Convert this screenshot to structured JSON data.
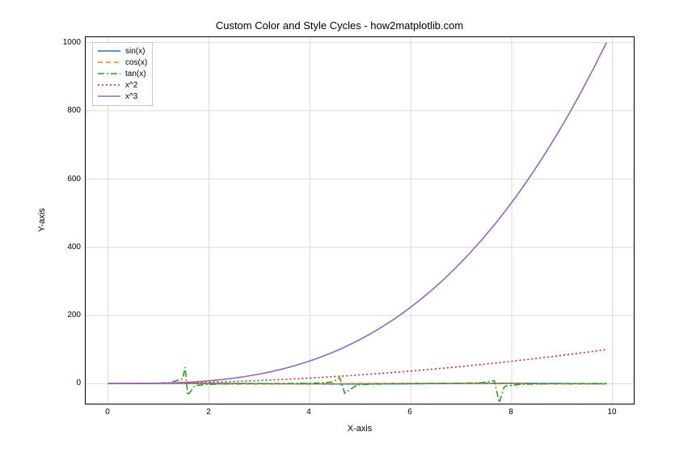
{
  "chart_data": {
    "type": "line",
    "title": "Custom Color and Style Cycles - how2matplotlib.com",
    "xlabel": "X-axis",
    "ylabel": "Y-axis",
    "xlim": [
      -0.446,
      10.546
    ],
    "ylim": [
      -58.7,
      1015.6
    ],
    "xticks": [
      0,
      2,
      4,
      6,
      8,
      10
    ],
    "yticks": [
      0,
      200,
      400,
      600,
      800,
      1000
    ],
    "grid": true,
    "legend_position": "upper-left",
    "x": [
      0,
      0.25,
      0.5,
      0.75,
      1,
      1.25,
      1.5,
      1.55,
      1.6,
      1.75,
      2,
      2.25,
      2.5,
      2.75,
      3,
      3.25,
      3.5,
      3.75,
      4,
      4.25,
      4.5,
      4.65,
      4.75,
      5,
      5.25,
      5.5,
      5.75,
      6,
      6.25,
      6.5,
      6.75,
      7,
      7.25,
      7.5,
      7.75,
      7.85,
      7.95,
      8,
      8.25,
      8.5,
      8.75,
      9,
      9.25,
      9.5,
      9.75,
      10
    ],
    "series": [
      {
        "name": "sin(x)",
        "color": "#1f77b4",
        "dash": "",
        "values": [
          0,
          0.247,
          0.479,
          0.682,
          0.841,
          0.949,
          0.997,
          0.9998,
          0.9996,
          0.984,
          0.909,
          0.778,
          0.599,
          0.382,
          0.141,
          -0.108,
          -0.351,
          -0.572,
          -0.757,
          -0.895,
          -0.978,
          -0.9988,
          -0.9993,
          -0.959,
          -0.859,
          -0.706,
          -0.508,
          -0.279,
          -0.033,
          0.215,
          0.45,
          0.657,
          0.825,
          0.938,
          0.993,
          0.9998,
          0.994,
          0.989,
          0.923,
          0.798,
          0.625,
          0.412,
          0.174,
          -0.075,
          -0.32,
          -0.544
        ]
      },
      {
        "name": "cos(x)",
        "color": "#ff7f0e",
        "dash": "6 4",
        "values": [
          1,
          0.969,
          0.878,
          0.732,
          0.54,
          0.315,
          0.071,
          0.021,
          -0.029,
          -0.178,
          -0.416,
          -0.628,
          -0.801,
          -0.924,
          -0.99,
          -0.994,
          -0.936,
          -0.821,
          -0.654,
          -0.446,
          -0.211,
          -0.062,
          0.035,
          0.284,
          0.513,
          0.709,
          0.862,
          0.96,
          0.9994,
          0.977,
          0.893,
          0.754,
          0.566,
          0.347,
          0.112,
          -0.012,
          -0.112,
          -0.146,
          -0.385,
          -0.602,
          -0.781,
          -0.911,
          -0.985,
          -0.997,
          -0.947,
          -0.839
        ]
      },
      {
        "name": "tan(x)",
        "color": "#2ca02c",
        "dash": "8 3 2 3",
        "values": [
          0,
          0.255,
          0.546,
          0.932,
          1.557,
          3.01,
          14.1,
          48.08,
          -34.23,
          -5.52,
          -2.185,
          -1.239,
          -0.747,
          -0.413,
          -0.143,
          0.109,
          0.375,
          0.697,
          1.158,
          2.006,
          4.637,
          17.47,
          -28.24,
          -3.381,
          -1.674,
          -0.996,
          -0.59,
          -0.291,
          -0.033,
          0.22,
          0.504,
          0.871,
          1.457,
          2.706,
          8.909,
          -55.87,
          -8.907,
          -6.8,
          -2.397,
          -1.326,
          -0.8,
          -0.452,
          -0.176,
          0.075,
          0.338,
          0.648
        ]
      },
      {
        "name": "x^2",
        "color": "#d62728",
        "dash": "2 3",
        "values": [
          0,
          0.063,
          0.25,
          0.563,
          1,
          1.563,
          2.25,
          2.403,
          2.56,
          3.063,
          4,
          5.063,
          6.25,
          7.563,
          9,
          10.56,
          12.25,
          14.06,
          16,
          18.06,
          20.25,
          21.62,
          22.56,
          25,
          27.56,
          30.25,
          33.06,
          36,
          39.06,
          42.25,
          45.56,
          49,
          52.56,
          56.25,
          60.06,
          61.62,
          63.2,
          64,
          68.06,
          72.25,
          76.56,
          81,
          85.56,
          90.25,
          95.06,
          100
        ]
      },
      {
        "name": "x^3",
        "color": "#9467bd",
        "dash": "",
        "values": [
          0,
          0.016,
          0.125,
          0.422,
          1,
          1.953,
          3.375,
          3.724,
          4.096,
          5.359,
          8,
          11.39,
          15.63,
          20.8,
          27,
          34.33,
          42.88,
          52.73,
          64,
          76.77,
          91.13,
          100.5,
          107.2,
          125,
          144.7,
          166.4,
          190.1,
          216,
          244.1,
          274.6,
          307.5,
          343,
          381.1,
          421.9,
          465.5,
          483.7,
          502.5,
          512,
          561.5,
          614.1,
          669.9,
          729,
          791.5,
          857.4,
          926.9,
          1000
        ]
      }
    ]
  }
}
